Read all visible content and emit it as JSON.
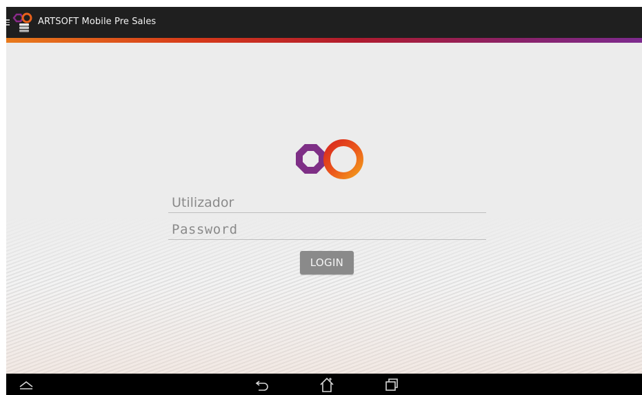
{
  "app_bar": {
    "title": "ARTSOFT Mobile Pre Sales",
    "icons": [
      "drawer-icon",
      "artsoft-app-icon"
    ]
  },
  "accent_colors": [
    "#e87a1c",
    "#d6391a",
    "#b01b2e",
    "#8a2268",
    "#7d2a8e"
  ],
  "login_form": {
    "logo": "artsoft-infinity-logo",
    "username": {
      "value": "",
      "placeholder": "Utilizador"
    },
    "password": {
      "value": "",
      "placeholder": "Password"
    },
    "login_label": "LOGIN",
    "button_color": "#8a8a8a"
  },
  "nav_bar": {
    "buttons": [
      "collapse-icon",
      "back-icon",
      "home-icon",
      "recent-apps-icon"
    ]
  }
}
